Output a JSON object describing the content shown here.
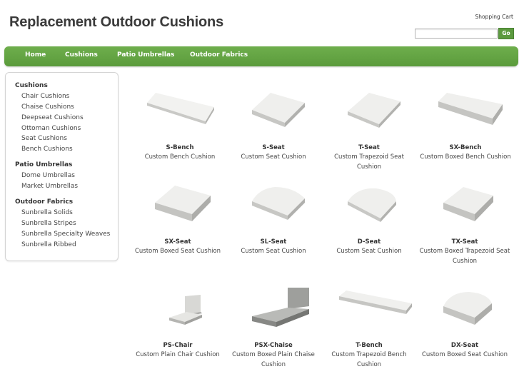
{
  "header": {
    "site_title": "Replacement Outdoor Cushions",
    "cart_label": "Shopping Cart",
    "search_placeholder": "",
    "go_label": "Go"
  },
  "nav": {
    "items": [
      "Home",
      "Cushions",
      "Patio Umbrellas",
      "Outdoor Fabrics"
    ]
  },
  "sidebar": {
    "sections": [
      {
        "heading": "Cushions",
        "links": [
          "Chair Cushions",
          "Chaise Cushions",
          "Deepseat Cushions",
          "Ottoman Cushions",
          "Seat Cushions",
          "Bench Cushions"
        ]
      },
      {
        "heading": "Patio Umbrellas",
        "links": [
          "Dome Umbrellas",
          "Market Umbrellas"
        ]
      },
      {
        "heading": "Outdoor Fabrics",
        "links": [
          "Sunbrella Solids",
          "Sunbrella Stripes",
          "Sunbrella Specialty Weaves",
          "Sunbrella Ribbed"
        ]
      }
    ]
  },
  "products": [
    {
      "name": "S-Bench",
      "desc": "Custom Bench Cushion",
      "icon": "bench-cushion-icon"
    },
    {
      "name": "S-Seat",
      "desc": "Custom Seat Cushion",
      "icon": "square-seat-cushion-icon"
    },
    {
      "name": "T-Seat",
      "desc": "Custom Trapezoid Seat Cushion",
      "icon": "trapezoid-seat-cushion-icon"
    },
    {
      "name": "SX-Bench",
      "desc": "Custom Boxed Bench Cushion",
      "icon": "boxed-bench-cushion-icon"
    },
    {
      "name": "SX-Seat",
      "desc": "Custom Boxed Seat Cushion",
      "icon": "boxed-seat-cushion-icon"
    },
    {
      "name": "SL-Seat",
      "desc": "Custom Seat Cushion",
      "icon": "rounded-seat-cushion-icon"
    },
    {
      "name": "D-Seat",
      "desc": "Custom Seat Cushion",
      "icon": "d-seat-cushion-icon"
    },
    {
      "name": "TX-Seat",
      "desc": "Custom Boxed Trapezoid Seat Cushion",
      "icon": "boxed-trapezoid-cushion-icon"
    },
    {
      "name": "PS-Chair",
      "desc": "Custom Plain Chair Cushion",
      "icon": "chair-cushion-icon"
    },
    {
      "name": "PSX-Chaise",
      "desc": "Custom Boxed Plain Chaise Cushion",
      "icon": "chaise-cushion-icon"
    },
    {
      "name": "T-Bench",
      "desc": "Custom Trapezoid Bench Cushion",
      "icon": "trapezoid-bench-cushion-icon"
    },
    {
      "name": "DX-Seat",
      "desc": "Custom Boxed Seat Cushion",
      "icon": "boxed-d-seat-cushion-icon"
    }
  ],
  "colors": {
    "nav_green": "#5f9f40",
    "cushion": "#e4e4e2",
    "cushion_shadow": "#a9a9a6"
  }
}
